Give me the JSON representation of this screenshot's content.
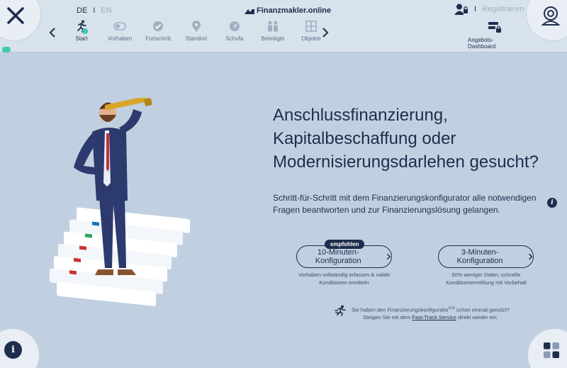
{
  "header": {
    "brand": "Finanzmakler.online",
    "lang_active": "DE",
    "lang_sep": "I",
    "lang_inactive": "EN",
    "user_sep": "I",
    "register_label": "Registrieren",
    "dashboard_label": "Angebots-Dashboard"
  },
  "steps": [
    {
      "label": "Start",
      "icon": "runner-icon"
    },
    {
      "label": "Vorhaben",
      "icon": "toggle-icon"
    },
    {
      "label": "Fortschritt",
      "icon": "check-icon"
    },
    {
      "label": "Standort",
      "icon": "location-pin-icon"
    },
    {
      "label": "Schufa",
      "icon": "gauge-icon"
    },
    {
      "label": "Beteiligte",
      "icon": "people-icon"
    },
    {
      "label": "Objekte",
      "icon": "building-icon"
    }
  ],
  "main": {
    "title_line1": "Anschlussfinanzierung,",
    "title_line2": "Kapitalbeschaffung oder",
    "title_line3": "Modernisierungsdarlehen gesucht?",
    "subtitle": "Schritt-für-Schritt mit dem Finanzierungskonfigurator alle notwendigen Fragen beantworten und zur Finanzierungslösung gelangen.",
    "recommended_badge": "empfohlen",
    "option1_label": "10-Minuten-Konfiguration",
    "option1_desc": "Vorhaben vollständig erfassen & valide Konditionen ermitteln",
    "option2_label": "3-Minuten-Konfiguration",
    "option2_desc": "50% weniger Daten, schnelle Konditionsermittlung mit Vorbehalt",
    "fasttrack_line1": "Sie haben den Finanzierungskonfigurator",
    "fasttrack_sup": "0+8",
    "fasttrack_line1b": "schon einmal genutzt?",
    "fasttrack_line2a": "Steigen Sie mit dem",
    "fasttrack_link": "Fast-Track Service",
    "fasttrack_line2b": "direkt wieder ein."
  },
  "colors": {
    "navy": "#1f2d4d",
    "accent": "#3ec9a8",
    "background": "#c0d0e0"
  }
}
